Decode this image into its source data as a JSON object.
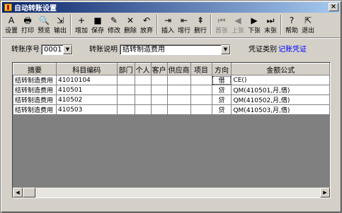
{
  "window": {
    "title": "自动转账设置"
  },
  "toolbar": {
    "buttons": [
      {
        "label": "设置",
        "icon": "settings-icon",
        "glyph": "A",
        "disabled": false
      },
      {
        "label": "打印",
        "icon": "print-icon",
        "glyph": "🖶",
        "disabled": false
      },
      {
        "label": "预览",
        "icon": "preview-icon",
        "glyph": "🔍",
        "disabled": false
      },
      {
        "label": "输出",
        "icon": "export-icon",
        "glyph": "⇲",
        "disabled": false
      },
      {
        "label": "增加",
        "icon": "add-icon",
        "glyph": "+",
        "disabled": false
      },
      {
        "label": "保存",
        "icon": "save-icon",
        "glyph": "■",
        "disabled": false
      },
      {
        "label": "修改",
        "icon": "edit-icon",
        "glyph": "✎",
        "disabled": false
      },
      {
        "label": "删除",
        "icon": "delete-icon",
        "glyph": "✕",
        "disabled": false
      },
      {
        "label": "放弃",
        "icon": "undo-icon",
        "glyph": "↶",
        "disabled": false
      },
      {
        "label": "插入",
        "icon": "insert-icon",
        "glyph": "⇥",
        "disabled": false
      },
      {
        "label": "增行",
        "icon": "add-row-icon",
        "glyph": "⇤",
        "disabled": false
      },
      {
        "label": "删行",
        "icon": "delete-row-icon",
        "glyph": "⇞",
        "disabled": false
      },
      {
        "label": "首张",
        "icon": "first-icon",
        "glyph": "⏮",
        "disabled": true
      },
      {
        "label": "上张",
        "icon": "prev-icon",
        "glyph": "◀",
        "disabled": true
      },
      {
        "label": "下张",
        "icon": "next-icon",
        "glyph": "▶",
        "disabled": false
      },
      {
        "label": "末张",
        "icon": "last-icon",
        "glyph": "⏭",
        "disabled": false
      },
      {
        "label": "帮助",
        "icon": "help-icon",
        "glyph": "?",
        "disabled": false
      },
      {
        "label": "退出",
        "icon": "exit-icon",
        "glyph": "⇱",
        "disabled": false
      }
    ]
  },
  "form": {
    "serial_label": "转账序号",
    "serial_value": "0001",
    "desc_label": "转账说明",
    "desc_value": "结转制造费用",
    "voucher_type_label": "凭证类别",
    "voucher_type_value": "记账凭证"
  },
  "grid": {
    "columns": [
      "摘要",
      "科目编码",
      "部门",
      "个人",
      "客户",
      "供应商",
      "项目",
      "方向",
      "金额公式"
    ],
    "rows": [
      {
        "summary": "结转制造费用",
        "code": "41010104",
        "dept": "",
        "person": "",
        "customer": "",
        "supplier": "",
        "project": "",
        "direction": "借",
        "formula": "CE()"
      },
      {
        "summary": "结转制造费用",
        "code": "410501",
        "dept": "",
        "person": "",
        "customer": "",
        "supplier": "",
        "project": "",
        "direction": "贷",
        "formula": "QM(410501,月,借)"
      },
      {
        "summary": "结转制造费用",
        "code": "410502",
        "dept": "",
        "person": "",
        "customer": "",
        "supplier": "",
        "project": "",
        "direction": "贷",
        "formula": "QM(410502,月,借)"
      },
      {
        "summary": "结转制造费用",
        "code": "410503",
        "dept": "",
        "person": "",
        "customer": "",
        "supplier": "",
        "project": "",
        "direction": "贷",
        "formula": "QM(410503,月,借)"
      }
    ]
  }
}
